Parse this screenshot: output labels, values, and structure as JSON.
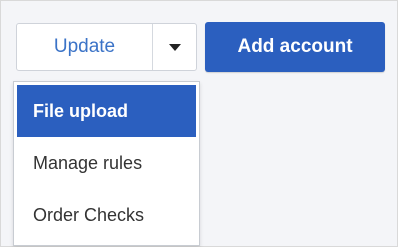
{
  "toolbar": {
    "update_label": "Update",
    "add_account_label": "Add account"
  },
  "menu": {
    "items": [
      {
        "label": "File upload",
        "state": "highlighted"
      },
      {
        "label": "Manage rules"
      },
      {
        "label": "Order Checks"
      }
    ]
  },
  "colors": {
    "primary": "#2b5fbf",
    "link_text": "#3b73c7"
  }
}
